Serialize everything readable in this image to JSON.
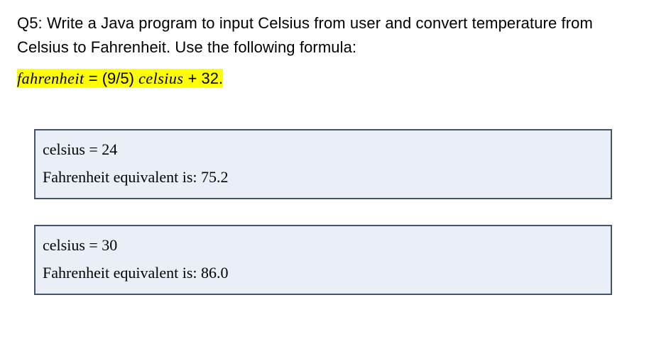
{
  "question": {
    "prefix": "Q5: ",
    "text": "Write a Java program to input Celsius from user and convert temperature from Celsius to Fahrenheit. Use the following formula:"
  },
  "formula": {
    "lhs_var": "fahrenheit",
    "eq": " = ",
    "coeff": "(9/5) ",
    "rhs_var": "celsius",
    "tail": " + 32."
  },
  "outputs": [
    {
      "line1": "celsius = 24",
      "line2": "Fahrenheit equivalent is: 75.2"
    },
    {
      "line1": "celsius = 30",
      "line2": "Fahrenheit equivalent is: 86.0"
    }
  ]
}
